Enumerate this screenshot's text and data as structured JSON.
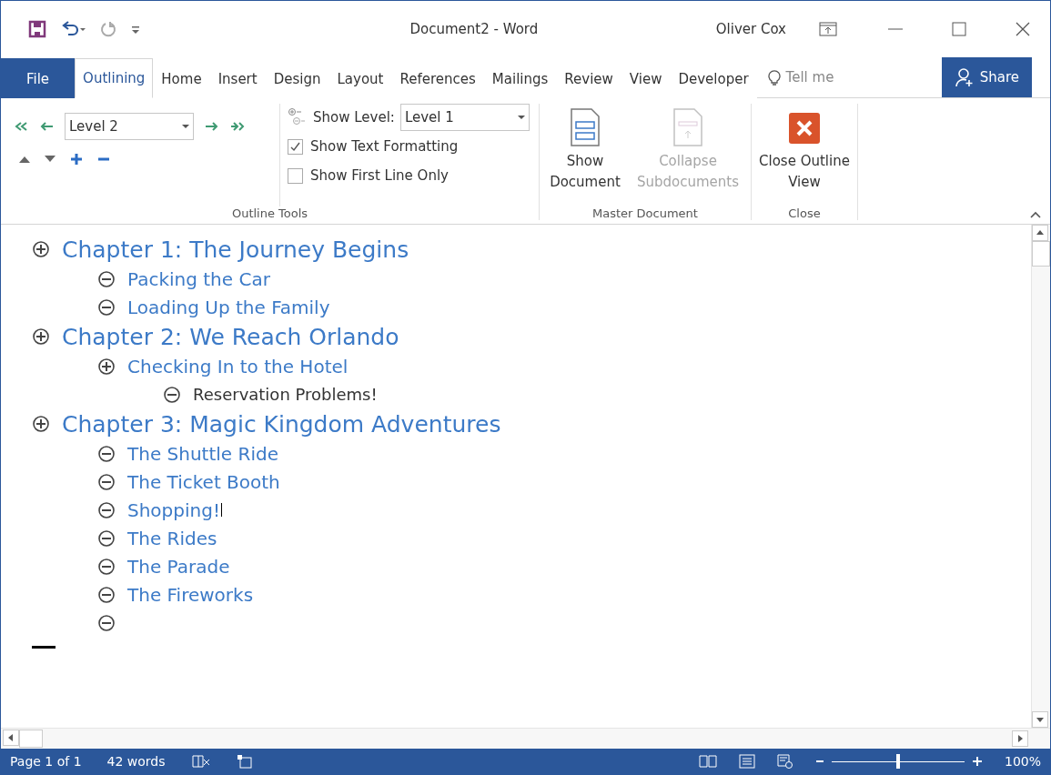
{
  "window": {
    "title": "Document2 - Word",
    "user": "Oliver Cox"
  },
  "tabs": [
    {
      "label": "File",
      "kind": "file",
      "selected": false
    },
    {
      "label": "Outlining",
      "kind": "tab",
      "selected": true
    },
    {
      "label": "Home",
      "kind": "tab",
      "selected": false
    },
    {
      "label": "Insert",
      "kind": "tab",
      "selected": false
    },
    {
      "label": "Design",
      "kind": "tab",
      "selected": false
    },
    {
      "label": "Layout",
      "kind": "tab",
      "selected": false
    },
    {
      "label": "References",
      "kind": "tab",
      "selected": false
    },
    {
      "label": "Mailings",
      "kind": "tab",
      "selected": false
    },
    {
      "label": "Review",
      "kind": "tab",
      "selected": false
    },
    {
      "label": "View",
      "kind": "tab",
      "selected": false
    },
    {
      "label": "Developer",
      "kind": "tab",
      "selected": false
    }
  ],
  "tell_me": {
    "placeholder": "Tell me"
  },
  "share_button": "Share",
  "ribbon": {
    "outline_tools": {
      "label": "Outline Tools",
      "level_value": "Level 2",
      "show_level_label": "Show Level:",
      "show_level_value": "Level 1",
      "checkboxes": [
        {
          "label": "Show Text Formatting",
          "checked": true
        },
        {
          "label": "Show First Line Only",
          "checked": false
        }
      ]
    },
    "master_document": {
      "label": "Master Document",
      "buttons": [
        {
          "label": "Show Document",
          "disabled": false
        },
        {
          "label": "Collapse Subdocuments",
          "disabled": true
        }
      ]
    },
    "close": {
      "label": "Close",
      "button": "Close Outline View"
    }
  },
  "outline": [
    {
      "text": "Chapter 1: The Journey Begins",
      "has_subheadings": true,
      "children": [
        {
          "text": "Packing the Car",
          "has_subheadings": false
        },
        {
          "text": "Loading Up the Family",
          "has_subheadings": false
        }
      ]
    },
    {
      "text": "Chapter 2: We Reach Orlando",
      "has_subheadings": true,
      "children": [
        {
          "text": "Checking In to the Hotel",
          "has_subheadings": true,
          "children": [
            {
              "text": "Reservation Problems!",
              "has_subheadings": false
            }
          ]
        }
      ]
    },
    {
      "text": "Chapter 3: Magic Kingdom Adventures",
      "has_subheadings": true,
      "children": [
        {
          "text": "The Shuttle Ride",
          "has_subheadings": false
        },
        {
          "text": "The Ticket Booth",
          "has_subheadings": false
        },
        {
          "text": "Shopping!",
          "has_subheadings": false,
          "cursor": true
        },
        {
          "text": "The Rides",
          "has_subheadings": false
        },
        {
          "text": "The Parade",
          "has_subheadings": false
        },
        {
          "text": "The Fireworks",
          "has_subheadings": false
        },
        {
          "has_subheadings": false
        }
      ]
    }
  ],
  "status_bar": {
    "page": "Page 1 of 1",
    "words": "42 words",
    "zoom": "100%",
    "zoom_slider": {
      "level": 0.5
    }
  }
}
